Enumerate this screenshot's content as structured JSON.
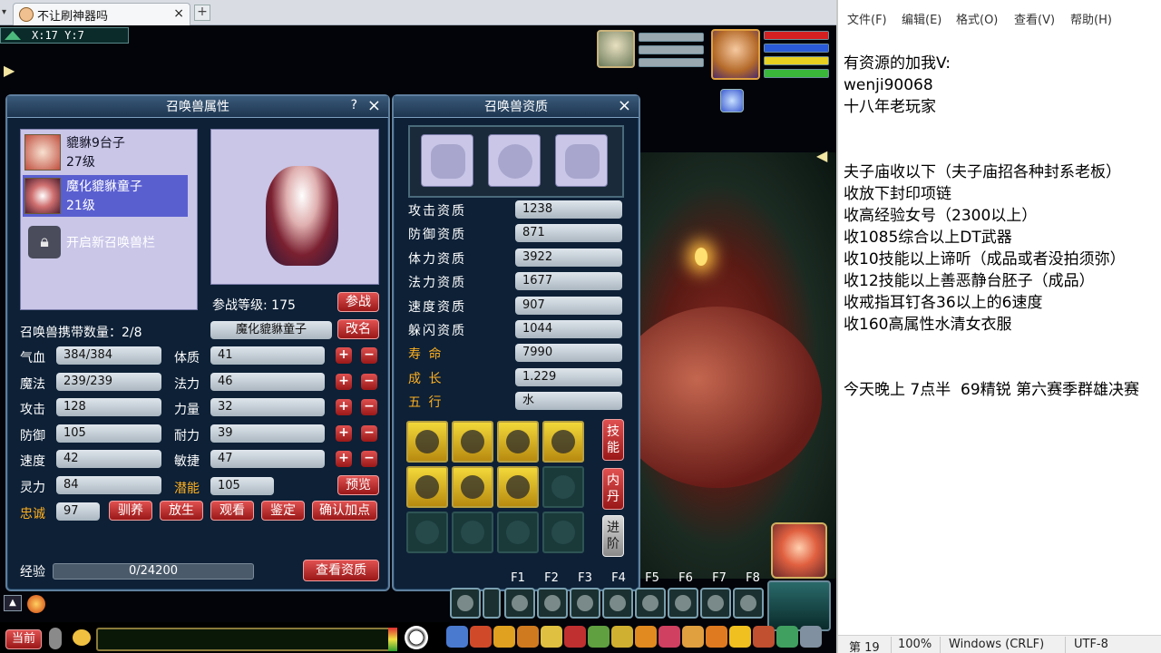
{
  "browser": {
    "tab_title": "不让刷神器吗",
    "tab_close": "×",
    "new_tab": "+"
  },
  "game": {
    "coords": "X:17 Y:7",
    "hero_bars": [
      {
        "color": "#d42020",
        "fill": 1.0
      },
      {
        "color": "#2a5ad8",
        "fill": 1.0
      },
      {
        "color": "#e8d020",
        "fill": 1.0
      },
      {
        "color": "#3ab83a",
        "fill": 1.0
      }
    ],
    "pet_bars": [
      {
        "color": "#9aa8b0",
        "fill": 1.0
      },
      {
        "color": "#9aa8b0",
        "fill": 1.0
      },
      {
        "color": "#9aa8b0",
        "fill": 1.0
      }
    ],
    "fkeys": [
      "F1",
      "F2",
      "F3",
      "F4",
      "F5",
      "F6",
      "F7",
      "F8"
    ],
    "chat_channel": "当前"
  },
  "attr_panel": {
    "title": "召唤兽属性",
    "help": "?",
    "close": "×",
    "pets": [
      {
        "name": "貔貅9台子",
        "level": "27级",
        "selected": false
      },
      {
        "name": "魔化貔貅童子",
        "level": "21级",
        "selected": true
      }
    ],
    "unlock_slot": "开启新召唤兽栏",
    "battle_level_label": "参战等级: 175",
    "battle_button": "参战",
    "carry_label": "召唤兽携带数量：2/8",
    "pet_name_value": "魔化貔貅童子",
    "rename_button": "改名",
    "left_stats": [
      {
        "label": "气血",
        "value": "384/384"
      },
      {
        "label": "魔法",
        "value": "239/239"
      },
      {
        "label": "攻击",
        "value": "128"
      },
      {
        "label": "防御",
        "value": "105"
      },
      {
        "label": "速度",
        "value": "42"
      },
      {
        "label": "灵力",
        "value": "84"
      }
    ],
    "right_stats": [
      {
        "label": "体质",
        "value": "41"
      },
      {
        "label": "法力",
        "value": "46"
      },
      {
        "label": "力量",
        "value": "32"
      },
      {
        "label": "耐力",
        "value": "39"
      },
      {
        "label": "敏捷",
        "value": "47"
      }
    ],
    "potential_label": "潜能",
    "potential_value": "105",
    "preview_button": "预览",
    "loyalty_label": "忠诚",
    "loyalty_value": "97",
    "actions": [
      "驯养",
      "放生",
      "观看",
      "鉴定",
      "确认加点"
    ],
    "exp_label": "经验",
    "exp_value": "0/24200",
    "exp_fraction": 0.0,
    "view_quality_button": "查看资质",
    "plus": "+",
    "minus": "−"
  },
  "quality_panel": {
    "title": "召唤兽资质",
    "close": "×",
    "rows": [
      {
        "label": "攻击资质",
        "value": "1238",
        "gold": false
      },
      {
        "label": "防御资质",
        "value": "871",
        "gold": false
      },
      {
        "label": "体力资质",
        "value": "3922",
        "gold": false
      },
      {
        "label": "法力资质",
        "value": "1677",
        "gold": false
      },
      {
        "label": "速度资质",
        "value": "907",
        "gold": false
      },
      {
        "label": "躲闪资质",
        "value": "1044",
        "gold": false
      },
      {
        "label": "寿 命",
        "value": "7990",
        "gold": true
      },
      {
        "label": "成 长",
        "value": "1.229",
        "gold": true
      },
      {
        "label": "五 行",
        "value": "水",
        "gold": true
      }
    ],
    "skill_tab": "技能",
    "neidan_tab": "内丹",
    "advance_tab": "进阶"
  },
  "notepad": {
    "menu": [
      "文件(F)",
      "编辑(E)",
      "格式(O)",
      "查看(V)",
      "帮助(H)"
    ],
    "lines": [
      "有资源的加我V:",
      "wenji90068",
      "十八年老玩家",
      "",
      "",
      "夫子庙收以下（夫子庙招各种封系老板）",
      "收放下封印项链",
      "收高经验女号（2300以上）",
      "收1085综合以上DT武器",
      "收10技能以上谛听（成品或者没拍须弥）",
      "收12技能以上善恶静台胚子（成品）",
      "收戒指耳钉各36以上的6速度",
      "收160高属性水清女衣服",
      "",
      "",
      "今天晚上 7点半  69精锐 第六赛季群雄决赛"
    ],
    "status": {
      "line": "第 19",
      "zoom": "100%",
      "eol": "Windows (CRLF)",
      "encoding": "UTF-8"
    }
  }
}
